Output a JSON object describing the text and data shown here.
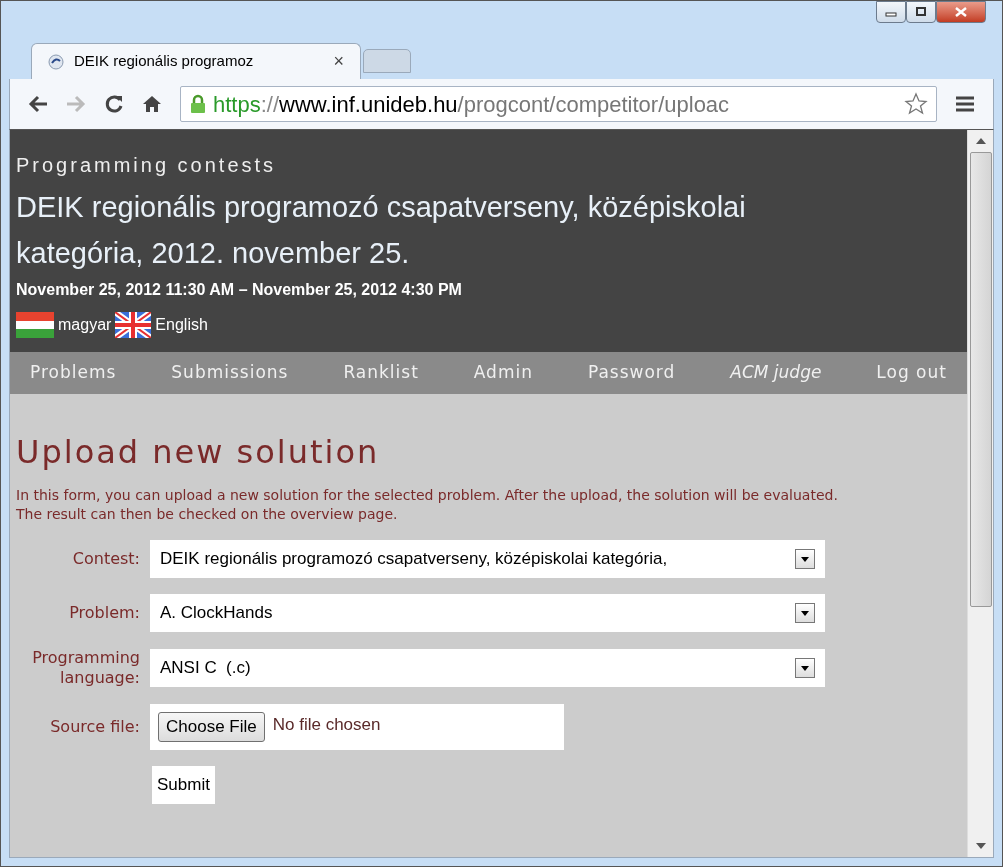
{
  "tabs": [
    {
      "kind": "page",
      "title": "DEIK regionális programoz",
      "selected": true,
      "close": "×"
    },
    {
      "kind": "new",
      "selected": false
    }
  ],
  "address": {
    "scheme": "https",
    "separator": "://",
    "host": "www.inf.unideb.hu",
    "path": "/progcont/competitor/uploac"
  },
  "header": {
    "site": "Programming contests",
    "title": "DEIK regionális programozó csapatverseny, középiskolai kategória, 2012. november 25.",
    "dates": "November 25, 2012 11:30 AM – November 25, 2012 4:30 PM",
    "languages": [
      {
        "label": "magyar",
        "kind": "hu"
      },
      {
        "label": "English",
        "kind": "uk"
      }
    ]
  },
  "nav": [
    {
      "label": "Problems",
      "italic": false
    },
    {
      "label": "Submissions",
      "italic": false
    },
    {
      "label": "Ranklist",
      "italic": false
    },
    {
      "label": "Admin",
      "italic": false
    },
    {
      "label": "Password",
      "italic": false
    },
    {
      "label": "ACM judge",
      "italic": true
    },
    {
      "label": "Log out",
      "italic": false
    }
  ],
  "form": {
    "heading": "Upload new solution",
    "intro": "In this form, you can upload a new solution for the selected problem. After the upload, the solution will be evaluated. The result can then be checked on the overview page.",
    "fields": [
      {
        "kind": "select",
        "label": "Contest:",
        "value": "DEIK regionális programozó csapatverseny, középiskolai kategória,"
      },
      {
        "kind": "select",
        "label": "Problem:",
        "value": "A. ClockHands"
      },
      {
        "kind": "select",
        "label": "Programming language:",
        "value": "ANSI C  (.c)"
      },
      {
        "kind": "file",
        "label": "Source file:",
        "button": "Choose File",
        "value": "No file chosen"
      }
    ],
    "submit": "Submit"
  }
}
